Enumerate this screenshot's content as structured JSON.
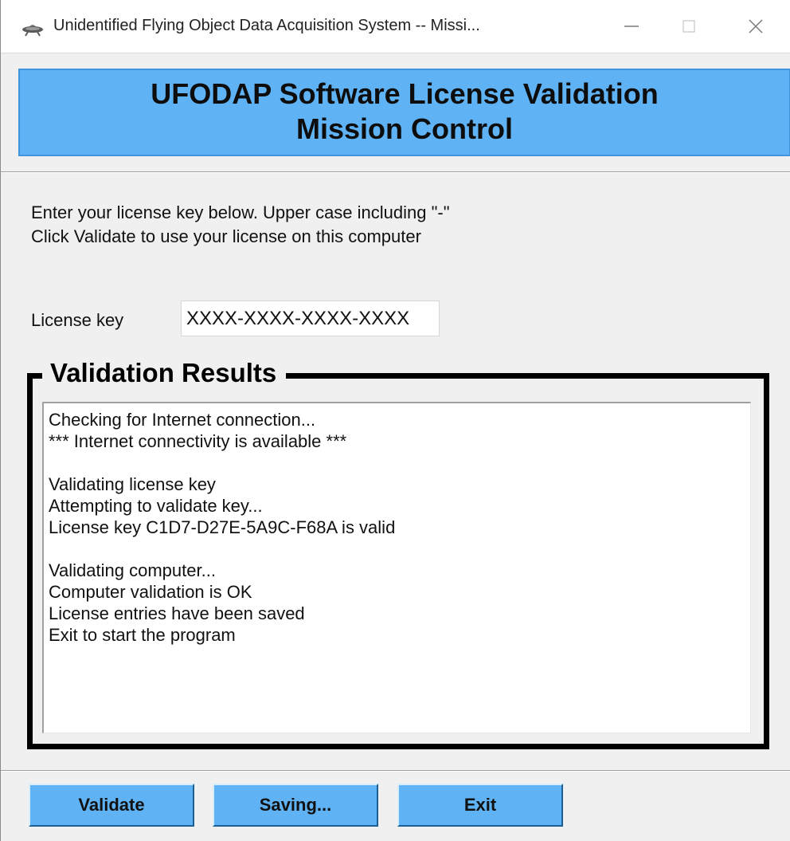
{
  "window": {
    "title": "Unidentified Flying Object Data Acquisition System -- Missi...",
    "icon": "ufo-icon"
  },
  "header": {
    "line1": "UFODAP Software License Validation",
    "line2": "Mission Control"
  },
  "instructions": {
    "line1": "Enter your license key below.  Upper case including \"-\"",
    "line2": "Click Validate to use your license on this computer"
  },
  "license": {
    "label": "License key",
    "placeholder": "XXXX-XXXX-XXXX-XXXX",
    "value": ""
  },
  "results": {
    "title": "Validation Results",
    "lines": [
      "Checking for Internet connection...",
      "*** Internet connectivity is available ***",
      "",
      "Validating license key",
      "Attempting to validate key...",
      "License key C1D7-D27E-5A9C-F68A is valid",
      "",
      "Validating computer...",
      "Computer validation is OK",
      "License entries have been saved",
      "Exit to start the program"
    ]
  },
  "buttons": {
    "validate": "Validate",
    "saving": "Saving...",
    "exit": "Exit"
  },
  "colors": {
    "accent": "#5fb3f5",
    "window_bg": "#f0f0f0"
  }
}
